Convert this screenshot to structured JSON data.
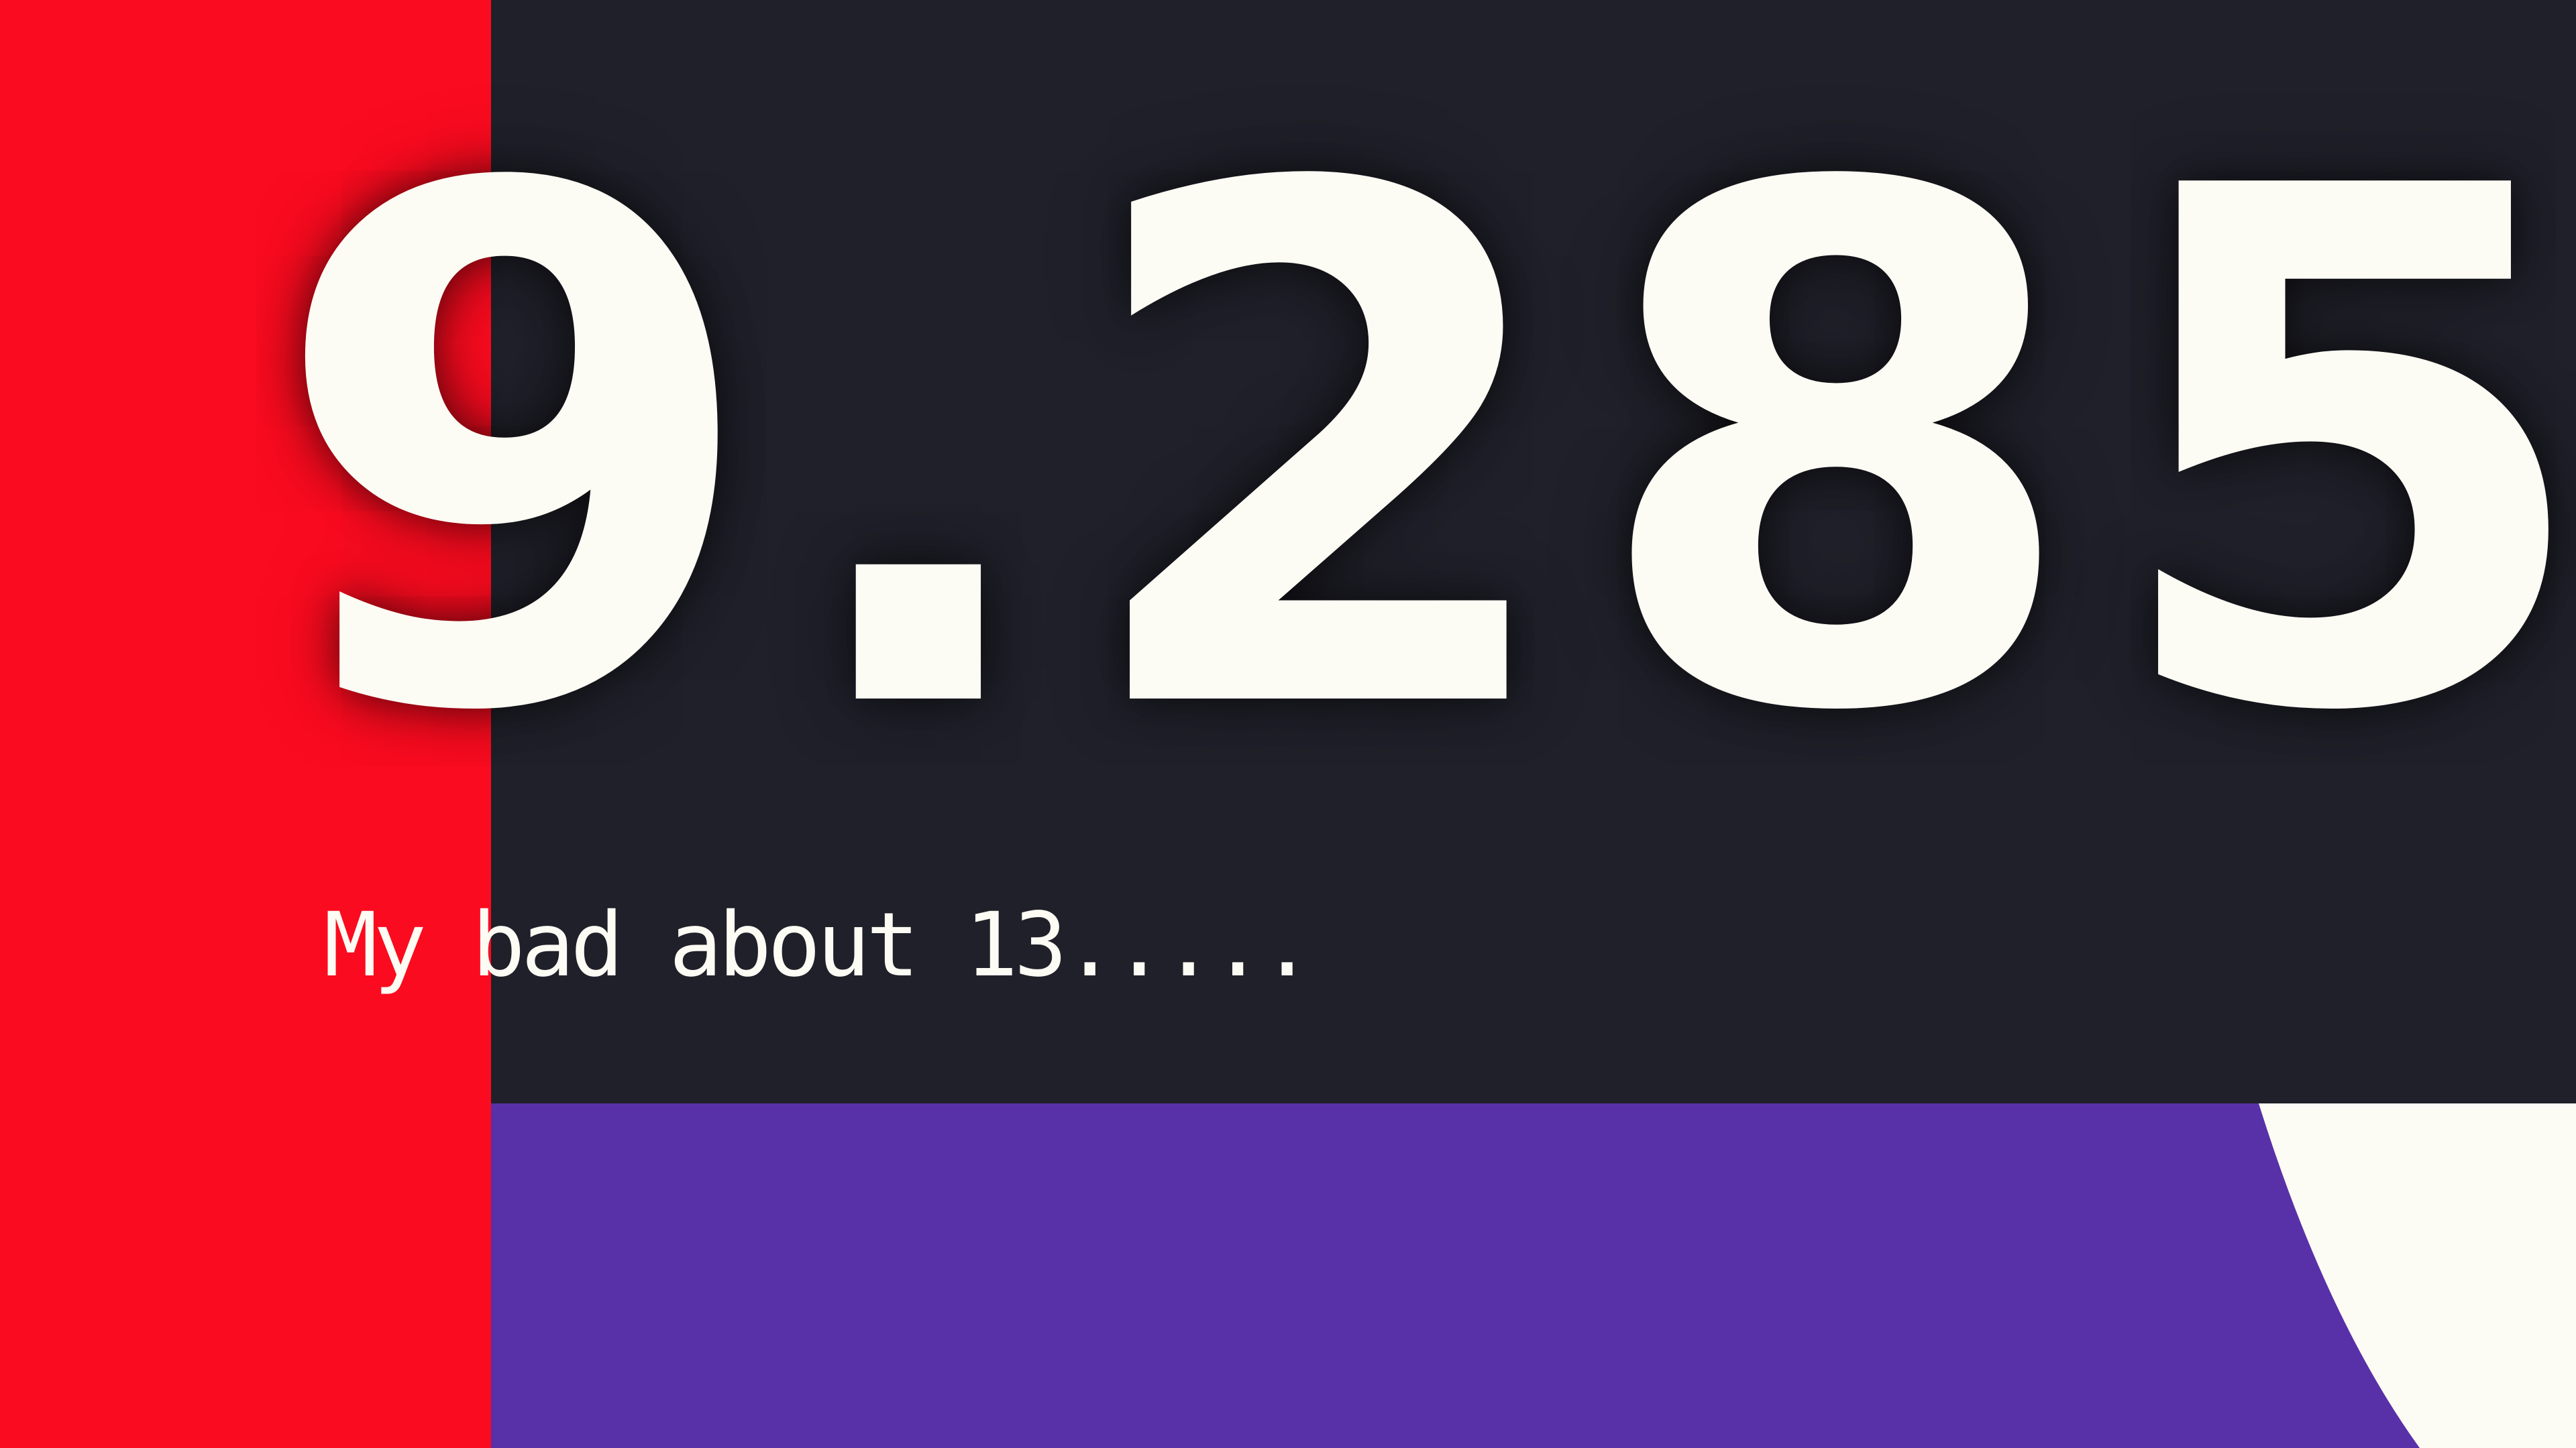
{
  "display": {
    "value": "9.285",
    "caption": "My bad about 13....."
  },
  "colors": {
    "background": "#20202a",
    "red_bar": "#fb0b1f",
    "purple_band": "#5830a8",
    "cream": "#fcfcf4",
    "text": "#fcfcf4"
  }
}
